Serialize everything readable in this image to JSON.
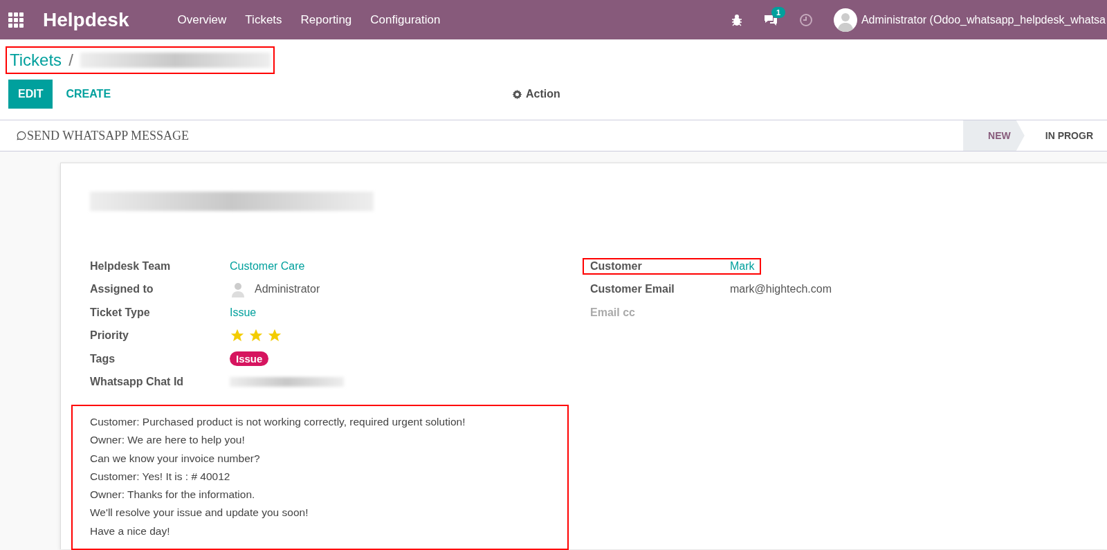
{
  "topbar": {
    "app_name": "Helpdesk",
    "menu": [
      "Overview",
      "Tickets",
      "Reporting",
      "Configuration"
    ],
    "message_count": "1",
    "user": "Administrator (Odoo_whatsapp_helpdesk_whatsa"
  },
  "breadcrumb": {
    "root": "Tickets",
    "separator": "/",
    "current_redacted": true,
    "highlighted": true
  },
  "buttons": {
    "edit": "EDIT",
    "create": "CREATE",
    "action": "Action"
  },
  "statusbar": {
    "whatsapp_button": "SEND WHATSAPP MESSAGE",
    "stages": [
      {
        "label": "NEW",
        "selected": true
      },
      {
        "label": "IN PROGR",
        "selected": false
      }
    ]
  },
  "sheet": {
    "title_redacted": true,
    "left_fields": [
      {
        "label": "Helpdesk Team",
        "kind": "link",
        "value": "Customer Care"
      },
      {
        "label": "Assigned to",
        "kind": "user",
        "value": "Administrator"
      },
      {
        "label": "Ticket Type",
        "kind": "link",
        "value": "Issue"
      },
      {
        "label": "Priority",
        "kind": "stars",
        "stars": 3
      },
      {
        "label": "Tags",
        "kind": "tag",
        "value": "Issue",
        "color": "#d6145f"
      },
      {
        "label": "Whatsapp Chat Id",
        "kind": "redacted"
      }
    ],
    "right_fields": [
      {
        "label": "Customer",
        "kind": "link",
        "value": "Mark",
        "highlighted": true,
        "muted": false
      },
      {
        "label": "Customer Email",
        "kind": "text",
        "value": "mark@hightech.com",
        "highlighted": false,
        "muted": false
      },
      {
        "label": "Email cc",
        "kind": "empty",
        "highlighted": false,
        "muted": true
      }
    ],
    "conversation": {
      "highlighted": true,
      "lines": [
        "Customer: Purchased product is not working correctly, required urgent solution!",
        "Owner: We are here to help you!",
        "Can we know your invoice number?",
        "Customer: Yes! It is : # 40012",
        "Owner: Thanks for the information.",
        "We'll resolve your issue and update you soon!",
        "Have a nice day!"
      ]
    }
  }
}
